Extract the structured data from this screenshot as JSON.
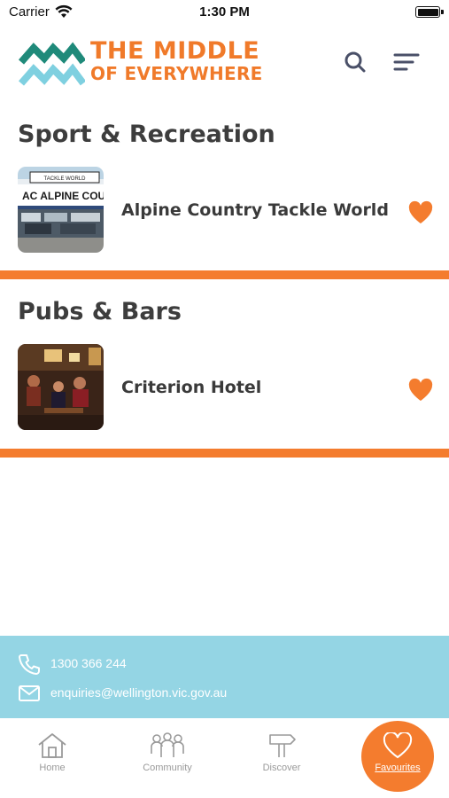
{
  "status_bar": {
    "carrier": "Carrier",
    "time": "1:30 PM"
  },
  "header": {
    "logo_line1": "THE MIDDLE",
    "logo_line2": "OF EVERYWHERE",
    "search_icon": "search-icon",
    "menu_icon": "menu-icon"
  },
  "sections": [
    {
      "title": "Sport & Recreation",
      "items": [
        {
          "name": "Alpine Country Tackle World",
          "thumb_sign_top": "TACKLE WORLD",
          "thumb_sign": "AC ALPINE COUN",
          "favourite": true
        }
      ]
    },
    {
      "title": "Pubs & Bars",
      "items": [
        {
          "name": "Criterion Hotel",
          "favourite": true
        }
      ]
    }
  ],
  "contact": {
    "phone": "1300 366 244",
    "email": "enquiries@wellington.vic.gov.au"
  },
  "tabs": [
    {
      "label": "Home",
      "icon": "home-icon",
      "active": false
    },
    {
      "label": "Community",
      "icon": "people-icon",
      "active": false
    },
    {
      "label": "Discover",
      "icon": "signpost-icon",
      "active": false
    },
    {
      "label": "Favourites",
      "icon": "heart-icon",
      "active": true
    }
  ],
  "colors": {
    "accent_orange": "#f47c2e",
    "contact_blue": "#94d5e4",
    "logo_teal": "#1f8a7a",
    "logo_light_blue": "#7fd0e0",
    "text_dark": "#3a3a3a"
  }
}
